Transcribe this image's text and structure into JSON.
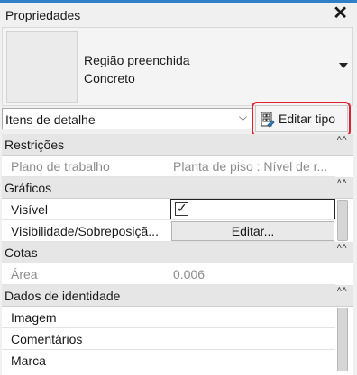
{
  "panel": {
    "title": "Propriedades",
    "close_symbol": "✕"
  },
  "type_selector": {
    "family": "Região preenchida",
    "type": "Concreto"
  },
  "filter": {
    "selected": "Itens de detalhe",
    "chevron": "⌵"
  },
  "edit_type_button": {
    "label": "Editar tipo"
  },
  "groups": {
    "restricoes": {
      "label": "Restrições",
      "collapse": "˄˄"
    },
    "graficos": {
      "label": "Gráficos",
      "collapse": "˄˄"
    },
    "cotas": {
      "label": "Cotas",
      "collapse": "˄˄"
    },
    "dados": {
      "label": "Dados de identidade",
      "collapse": "˄˄"
    }
  },
  "rows": {
    "plano": {
      "name": "Plano de trabalho",
      "value": "Planta de piso : Nível de r..."
    },
    "visivel": {
      "name": "Visível",
      "checked": true,
      "check_mark": "✓"
    },
    "visibilidade": {
      "name": "Visibilidade/Sobreposiçã...",
      "button": "Editar..."
    },
    "area": {
      "name": "Área",
      "value": "0.006"
    },
    "imagem": {
      "name": "Imagem",
      "value": ""
    },
    "comentarios": {
      "name": "Comentários",
      "value": ""
    },
    "marca": {
      "name": "Marca",
      "value": ""
    }
  },
  "colors": {
    "highlight": "#e0202c",
    "accent": "#2f80c6"
  }
}
